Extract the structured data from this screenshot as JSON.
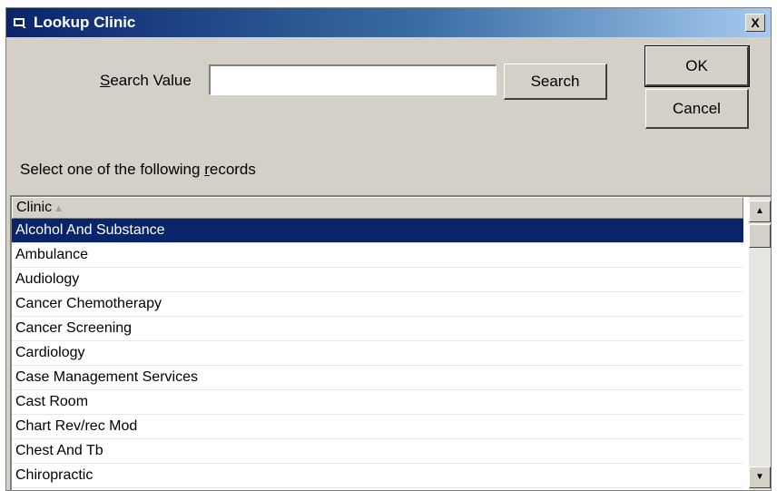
{
  "window": {
    "title": "Lookup Clinic",
    "close_label": "X"
  },
  "search": {
    "label": "Search Value",
    "value": "",
    "placeholder": "",
    "button_label": "Search"
  },
  "buttons": {
    "ok_label": "OK",
    "cancel_label": "Cancel"
  },
  "records_label": "Select one of the following records",
  "list": {
    "column_header": "Clinic",
    "sort_indicator": "ascending",
    "selected_index": 0,
    "items": [
      "Alcohol And Substance",
      "Ambulance",
      "Audiology",
      "Cancer Chemotherapy",
      "Cancer Screening",
      "Cardiology",
      "Case Management Services",
      "Cast Room",
      "Chart Rev/rec Mod",
      "Chest And Tb",
      "Chiropractic"
    ]
  },
  "colors": {
    "title_bar": "#0a246a",
    "selection": "#0a246a",
    "dialog_face": "#d4d0c8"
  }
}
